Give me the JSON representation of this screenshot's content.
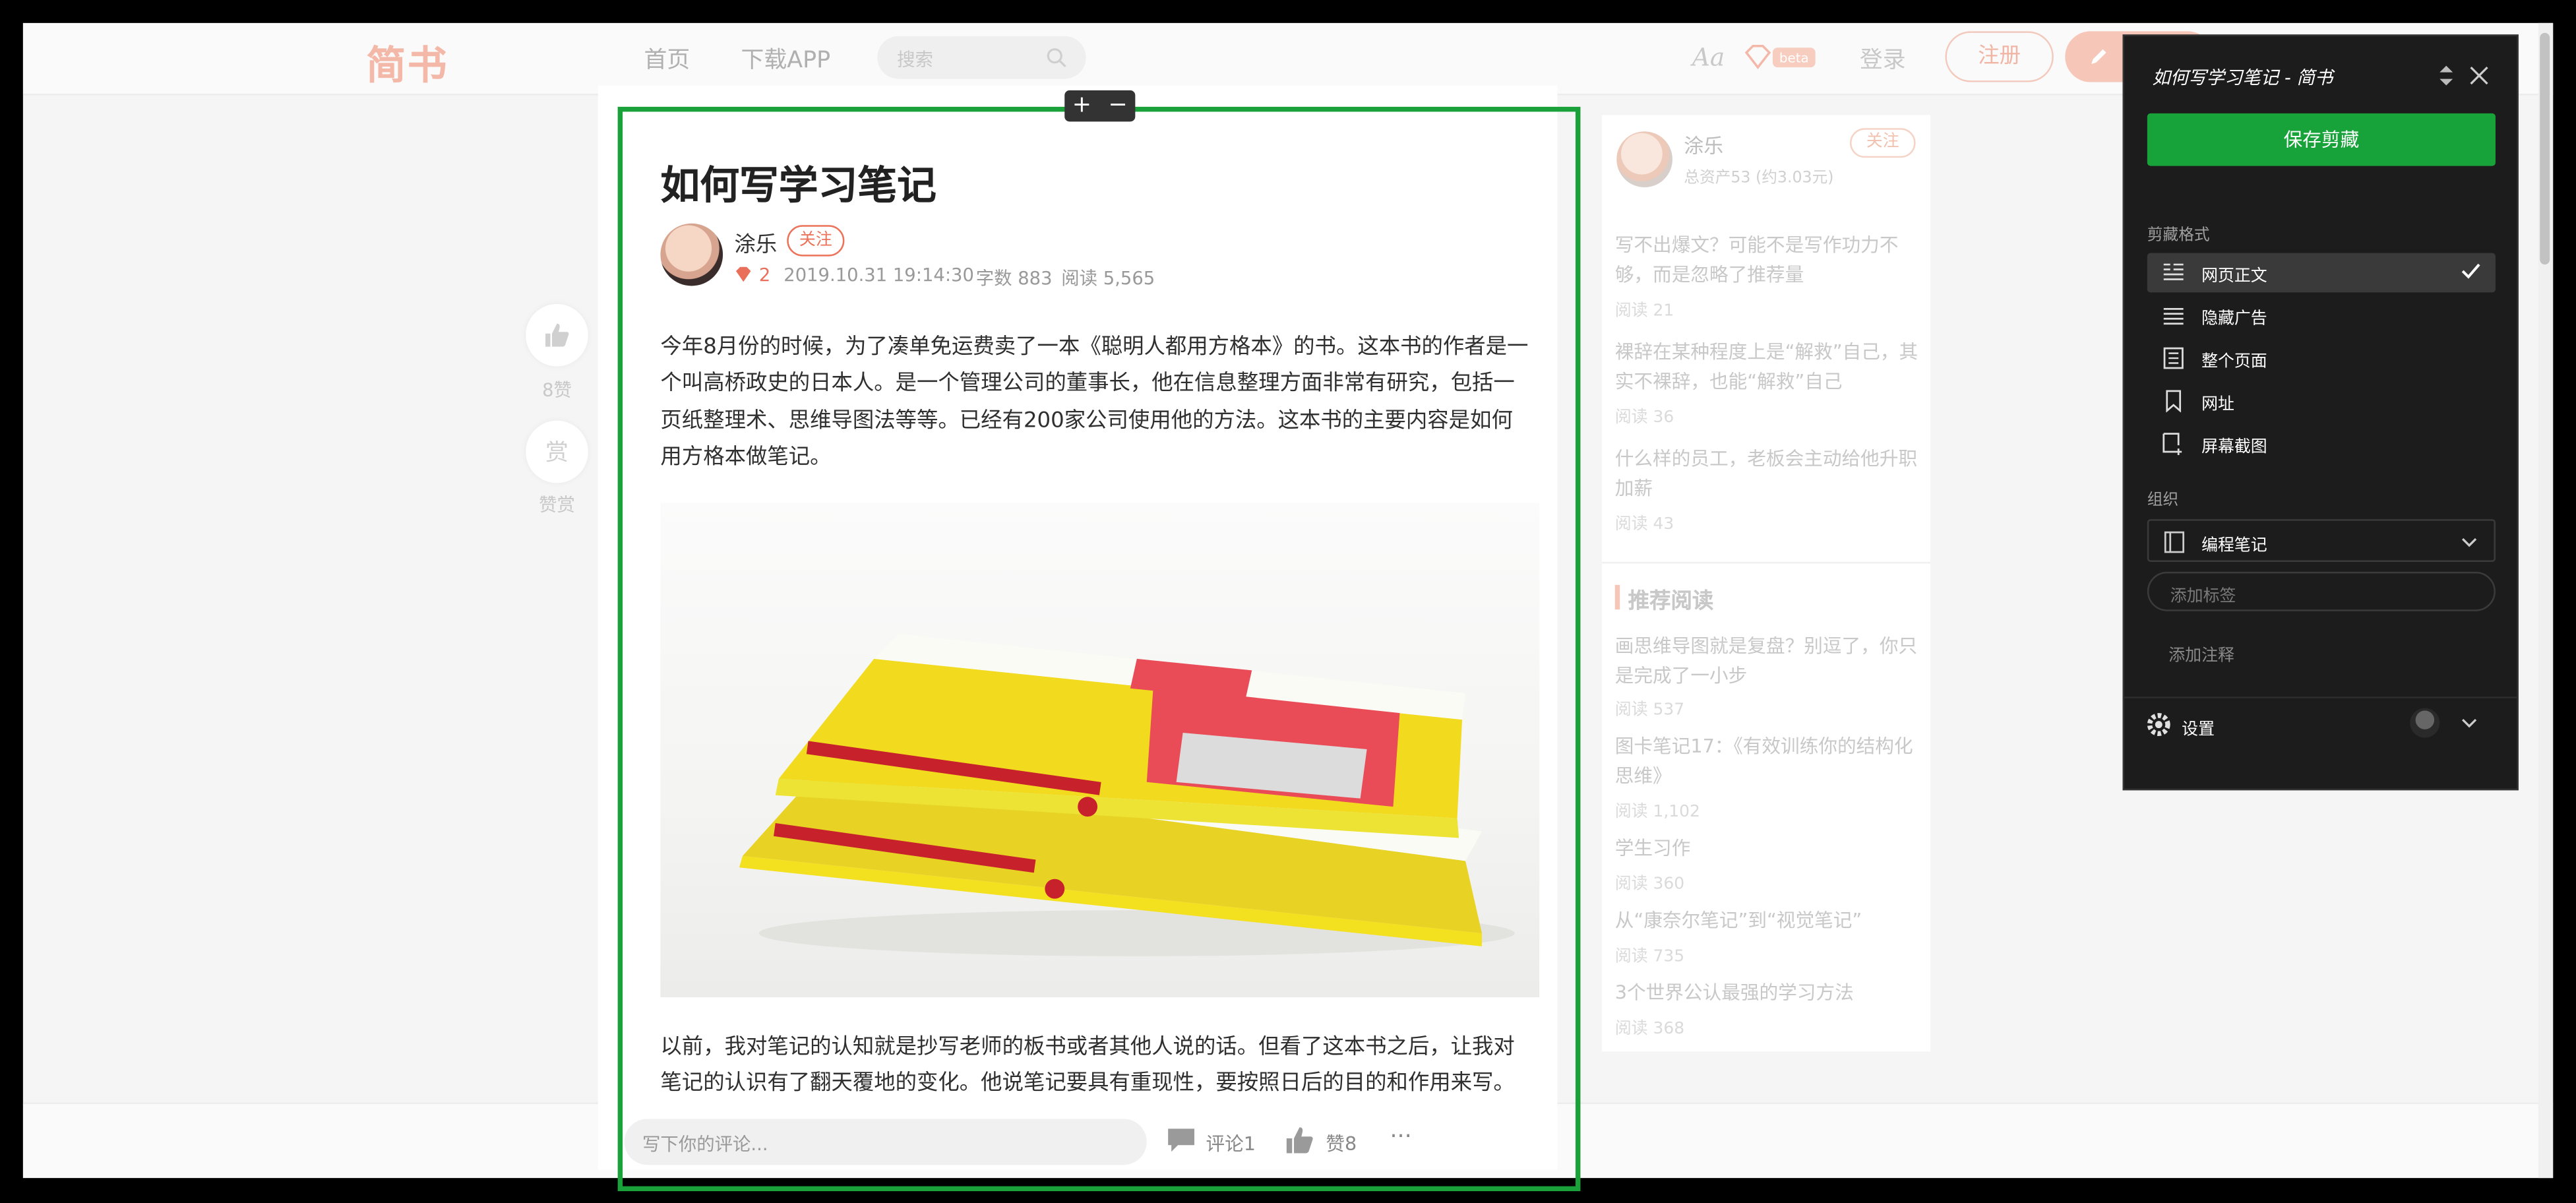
{
  "site": {
    "logo": "简书",
    "nav": [
      "首页",
      "下载APP"
    ],
    "search_placeholder": "搜索",
    "font_toggle": "Aa",
    "beta_badge": "beta",
    "login": "登录",
    "signup": "注册"
  },
  "article": {
    "title": "如何写学习笔记",
    "author": "涂乐",
    "follow": "关注",
    "diamond_count": "2",
    "date": "2019.10.31 19:14:30",
    "word_count": "字数 883",
    "read_count": "阅读 5,565",
    "para1": "今年8月份的时候，为了凑单免运费卖了一本《聪明人都用方格本》的书。这本书的作者是一个叫高桥政史的日本人。是一个管理公司的董事长，他在信息整理方面非常有研究，包括一页纸整理术、思维导图法等等。已经有200家公司使用他的方法。这本书的主要内容是如何用方格本做笔记。",
    "para2": "以前，我对笔记的认知就是抄写老师的板书或者其他人说的话。但看了这本书之后，让我对笔记的认识有了翻天覆地的变化。他说笔记要具有重现性，要按照日后的目的和作用来写。他还"
  },
  "left_actions": {
    "like_count": "8赞",
    "reward_char": "赏",
    "reward_label": "赞赏"
  },
  "sidebar": {
    "author": "涂乐",
    "assets": "总资产53 (约3.03元)",
    "follow": "关注",
    "posts": [
      {
        "title": "写不出爆文？可能不是写作功力不够，而是忽略了推荐量",
        "reads": "阅读 21"
      },
      {
        "title": "裸辞在某种程度上是“解救”自己，其实不裸辞，也能“解救”自己",
        "reads": "阅读 36"
      },
      {
        "title": "什么样的员工，老板会主动给他升职加薪",
        "reads": "阅读 43"
      }
    ],
    "recommend_heading": "推荐阅读",
    "recommend": [
      {
        "title": "画思维导图就是复盘？别逗了，你只是完成了一小步",
        "reads": "阅读 537"
      },
      {
        "title": "图卡笔记17：《有效训练你的结构化思维》",
        "reads": "阅读 1,102"
      },
      {
        "title": "学生习作",
        "reads": "阅读 360"
      },
      {
        "title": "从“康奈尔笔记”到“视觉笔记”",
        "reads": "阅读 735"
      },
      {
        "title": "3个世界公认最强的学习方法",
        "reads": "阅读 368"
      }
    ]
  },
  "bottom_bar": {
    "comment_placeholder": "写下你的评论...",
    "comments": "评论1",
    "likes": "赞8",
    "more": "···"
  },
  "clipper": {
    "title": "如何写学习笔记 - 简书",
    "save": "保存剪藏",
    "format_heading": "剪藏格式",
    "formats": [
      "网页正文",
      "隐藏广告",
      "整个页面",
      "网址",
      "屏幕截图"
    ],
    "selected_format": "网页正文",
    "org_heading": "组织",
    "notebook": "编程笔记",
    "tag_placeholder": "添加标签",
    "note_placeholder": "添加注释",
    "settings": "设置"
  },
  "selection_controls": {
    "plus": "+",
    "minus": "−"
  },
  "colors": {
    "brand": "#ea6f5a",
    "clipper_green": "#18a23a",
    "selection_green": "#1aa139",
    "panel_bg": "#1c1c1c"
  }
}
